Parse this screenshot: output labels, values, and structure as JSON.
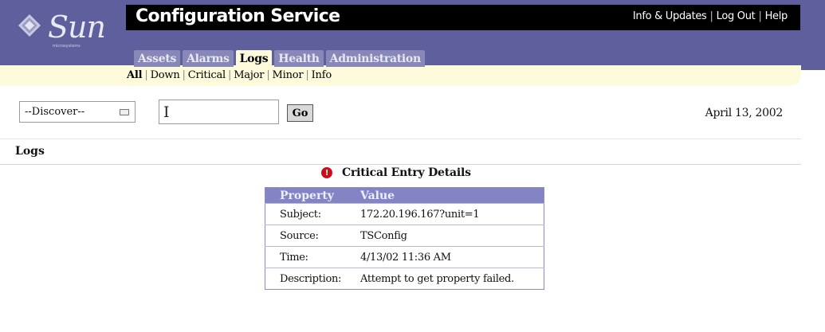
{
  "header": {
    "brand": "Sun",
    "brand_sub": "microsystems",
    "app_title": "Configuration Service",
    "links": [
      "Info & Updates",
      "Log Out",
      "Help"
    ]
  },
  "tabs": [
    {
      "label": "Assets",
      "active": false
    },
    {
      "label": "Alarms",
      "active": false
    },
    {
      "label": "Logs",
      "active": true
    },
    {
      "label": "Health",
      "active": false
    },
    {
      "label": "Administration",
      "active": false
    }
  ],
  "subnav": [
    {
      "label": "All",
      "active": true
    },
    {
      "label": "Down",
      "active": false
    },
    {
      "label": "Critical",
      "active": false
    },
    {
      "label": "Major",
      "active": false
    },
    {
      "label": "Minor",
      "active": false
    },
    {
      "label": "Info",
      "active": false
    }
  ],
  "controls": {
    "select_value": "--Discover--",
    "input_value": "",
    "go_label": "Go",
    "date": "April 13, 2002"
  },
  "section": {
    "title": "Logs"
  },
  "details": {
    "heading": "Critical Entry Details",
    "icon": "critical-alert-icon",
    "columns": [
      "Property",
      "Value"
    ],
    "rows": [
      {
        "property": "Subject:",
        "value": "172.20.196.167?unit=1"
      },
      {
        "property": "Source:",
        "value": "TSConfig"
      },
      {
        "property": "Time:",
        "value": "4/13/02 11:36 AM"
      },
      {
        "property": "Description:",
        "value": "Attempt to get property failed."
      }
    ]
  },
  "colors": {
    "header_bg": "#5f5f9e",
    "subnav_bg": "#fdfbdc",
    "table_header_bg": "#8484c4",
    "critical": "#c8101a"
  }
}
